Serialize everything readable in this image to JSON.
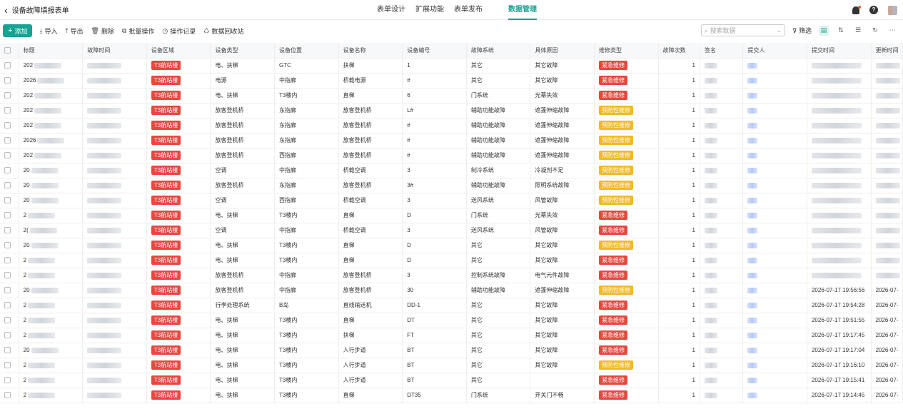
{
  "header": {
    "title": "设备故障填报表单",
    "tabs": [
      "表单设计",
      "扩展功能",
      "表单发布",
      "数据管理"
    ],
    "active_tab": "数据管理",
    "accent": "#16a394"
  },
  "toolbar": {
    "add": "添加",
    "import": "导入",
    "export": "导出",
    "delete": "删除",
    "batch": "批量操作",
    "log": "操作记录",
    "recycle": "数据回收站",
    "search_placeholder": "搜索数据",
    "filter": "筛选"
  },
  "columns": [
    "标题",
    "故障时间",
    "设备区域",
    "设备类型",
    "设备位置",
    "设备名称",
    "设备编号",
    "故障系统",
    "具体原因",
    "维修类型",
    "故障次数",
    "签名",
    "提交人",
    "提交时间",
    "更新时间"
  ],
  "rows": [
    {
      "title": "202",
      "area": "T3航站楼",
      "type": "电、扶梯",
      "loc": "GTC",
      "name": "扶梯",
      "code": "1",
      "sys": "其它",
      "reason": "其它故障",
      "repair": "紧急维修",
      "count": "1",
      "submit": "",
      "update": ""
    },
    {
      "title": "2026",
      "area": "T3航站楼",
      "type": "电源",
      "loc": "中指廊",
      "name": "桥载电源",
      "code": "#",
      "sys": "其它",
      "reason": "其它故障",
      "repair": "紧急维修",
      "count": "1",
      "submit": "",
      "update": ""
    },
    {
      "title": "202",
      "area": "T3航站楼",
      "type": "电、扶梯",
      "loc": "T3楼内",
      "name": "直梯",
      "code": "6",
      "sys": "门系统",
      "reason": "光幕失效",
      "repair": "紧急维修",
      "count": "1",
      "submit": "",
      "update": ""
    },
    {
      "title": "202",
      "area": "T3航站楼",
      "type": "旅客登机桥",
      "loc": "东指廊",
      "name": "旅客登机桥",
      "code": "L#",
      "sys": "辅助功能故障",
      "reason": "遮蓬伸缩故障",
      "repair": "预防性维修",
      "count": "1",
      "submit": "",
      "update": ""
    },
    {
      "title": "202",
      "area": "T3航站楼",
      "type": "旅客登机桥",
      "loc": "东指廊",
      "name": "旅客登机桥",
      "code": "#",
      "sys": "辅助功能故障",
      "reason": "遮蓬伸缩故障",
      "repair": "预防性维修",
      "count": "1",
      "submit": "",
      "update": ""
    },
    {
      "title": "2026",
      "area": "T3航站楼",
      "type": "旅客登机桥",
      "loc": "东指廊",
      "name": "旅客登机桥",
      "code": "#",
      "sys": "辅助功能故障",
      "reason": "遮蓬伸缩故障",
      "repair": "预防性维修",
      "count": "1",
      "submit": "",
      "update": ""
    },
    {
      "title": "202",
      "area": "T3航站楼",
      "type": "旅客登机桥",
      "loc": "西指廊",
      "name": "旅客登机桥",
      "code": "#",
      "sys": "辅助功能故障",
      "reason": "遮蓬伸缩故障",
      "repair": "预防性维修",
      "count": "1",
      "submit": "",
      "update": ""
    },
    {
      "title": "20",
      "area": "T3航站楼",
      "type": "空调",
      "loc": "中指廊",
      "name": "桥载空调",
      "code": "3",
      "sys": "制冷系统",
      "reason": "冷凝剂不足",
      "repair": "预防性维修",
      "count": "1",
      "submit": "",
      "update": ""
    },
    {
      "title": "20",
      "area": "T3航站楼",
      "type": "旅客登机桥",
      "loc": "东指廊",
      "name": "旅客登机桥",
      "code": "3#",
      "sys": "辅助功能故障",
      "reason": "照明系统故障",
      "repair": "预防性维修",
      "count": "1",
      "submit": "",
      "update": ""
    },
    {
      "title": "20",
      "area": "T3航站楼",
      "type": "空调",
      "loc": "西指廊",
      "name": "桥载空调",
      "code": "3",
      "sys": "送风系统",
      "reason": "风管故障",
      "repair": "预防性维修",
      "count": "1",
      "submit": "",
      "update": ""
    },
    {
      "title": "2",
      "area": "T3航站楼",
      "type": "电、扶梯",
      "loc": "T3楼内",
      "name": "直梯",
      "code": "D",
      "sys": "门系统",
      "reason": "光幕失效",
      "repair": "紧急维修",
      "count": "1",
      "submit": "",
      "update": ""
    },
    {
      "title": "2(",
      "area": "T3航站楼",
      "type": "空调",
      "loc": "中指廊",
      "name": "桥载空调",
      "code": "3",
      "sys": "送风系统",
      "reason": "风管故障",
      "repair": "紧急维修",
      "count": "1",
      "submit": "",
      "update": ""
    },
    {
      "title": "20",
      "area": "T3航站楼",
      "type": "电、扶梯",
      "loc": "T3楼内",
      "name": "直梯",
      "code": "D",
      "sys": "其它",
      "reason": "其它故障",
      "repair": "预防性维修",
      "count": "1",
      "submit": "",
      "update": ""
    },
    {
      "title": "2",
      "area": "T3航站楼",
      "type": "电、扶梯",
      "loc": "T3楼内",
      "name": "直梯",
      "code": "D",
      "sys": "其它",
      "reason": "其它故障",
      "repair": "紧急维修",
      "count": "1",
      "submit": "",
      "update": ""
    },
    {
      "title": "2",
      "area": "T3航站楼",
      "type": "旅客登机桥",
      "loc": "中指廊",
      "name": "旅客登机桥",
      "code": "3",
      "sys": "控制系统故障",
      "reason": "电气元件故障",
      "repair": "紧急维修",
      "count": "1",
      "submit": "",
      "update": ""
    },
    {
      "title": "20",
      "area": "T3航站楼",
      "type": "旅客登机桥",
      "loc": "中指廊",
      "name": "旅客登机桥",
      "code": "30",
      "sys": "辅助功能故障",
      "reason": "遮蓬伸缩故障",
      "repair": "预防性维修",
      "count": "1",
      "submit": "2026-07-17 19:56:56",
      "update": "2026-07-"
    },
    {
      "title": "2",
      "area": "T3航站楼",
      "type": "行李处理系统",
      "loc": "B岛",
      "name": "直线输送机",
      "code": "DD-1",
      "sys": "其它",
      "reason": "其它故障",
      "repair": "紧急维修",
      "count": "1",
      "submit": "2026-07-17 19:54:28",
      "update": "2026-07-"
    },
    {
      "title": "2",
      "area": "T3航站楼",
      "type": "电、扶梯",
      "loc": "T3楼内",
      "name": "直梯",
      "code": "DT",
      "sys": "其它",
      "reason": "其它故障",
      "repair": "紧急维修",
      "count": "1",
      "submit": "2026-07-17 19:51:55",
      "update": "2026-07-"
    },
    {
      "title": "2",
      "area": "T3航站楼",
      "type": "电、扶梯",
      "loc": "T3楼内",
      "name": "扶梯",
      "code": "FT",
      "sys": "其它",
      "reason": "其它故障",
      "repair": "紧急维修",
      "count": "1",
      "submit": "2026-07-17 19:17:45",
      "update": "2026-07-"
    },
    {
      "title": "20",
      "area": "T3航站楼",
      "type": "电、扶梯",
      "loc": "T3楼内",
      "name": "人行步道",
      "code": "BT",
      "sys": "其它",
      "reason": "其它故障",
      "repair": "紧急维修",
      "count": "1",
      "submit": "2026-07-17 19:17:04",
      "update": "2026-07-"
    },
    {
      "title": "2",
      "area": "T3航站楼",
      "type": "电、扶梯",
      "loc": "T3楼内",
      "name": "人行步道",
      "code": "BT",
      "sys": "其它",
      "reason": "其它故障",
      "repair": "预防性维修",
      "count": "1",
      "submit": "2026-07-17 19:16:10",
      "update": "2026-07-"
    },
    {
      "title": "2",
      "area": "T3航站楼",
      "type": "电、扶梯",
      "loc": "T3楼内",
      "name": "人行步道",
      "code": "BT",
      "sys": "其它",
      "reason": "",
      "repair": "紧急维修",
      "count": "1",
      "submit": "2026-07-17 19:15:41",
      "update": "2026-07-"
    },
    {
      "title": "2",
      "area": "T3航站楼",
      "type": "电、扶梯",
      "loc": "T3楼内",
      "name": "直梯",
      "code": "DT35",
      "sys": "门系统",
      "reason": "开关门不畅",
      "repair": "紧急维修",
      "count": "1",
      "submit": "2026-07-17 19:14:45",
      "update": "2026-07-"
    }
  ],
  "tag_colors": {
    "紧急维修": "#e8473f",
    "预防性维修": "#f2b928",
    "T3航站楼": "#e8473f"
  }
}
